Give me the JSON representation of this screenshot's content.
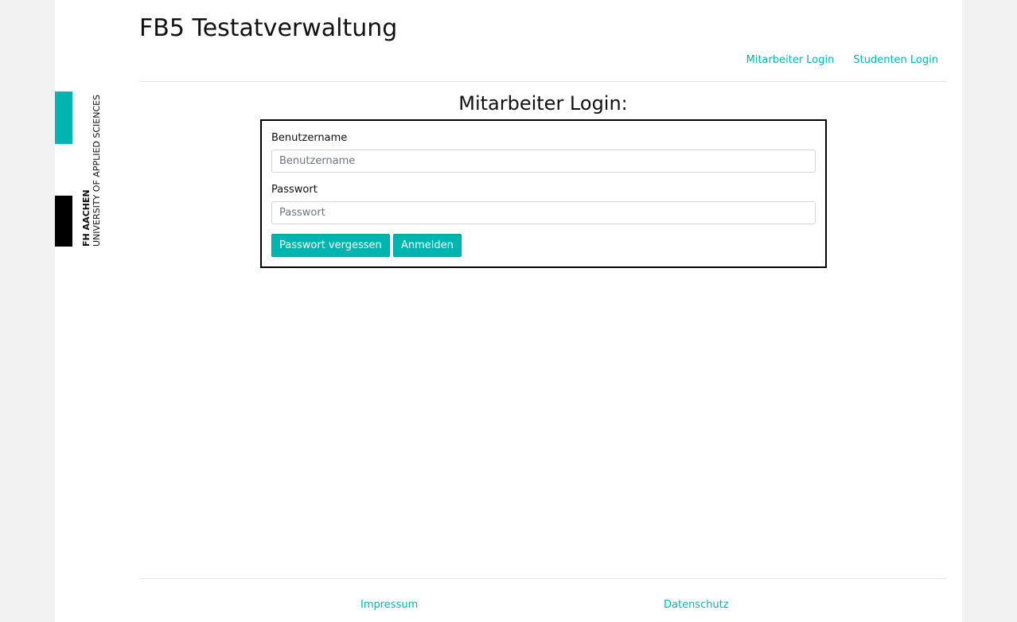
{
  "logo": {
    "name": "FH AACHEN",
    "subtitle": "UNIVERSITY OF APPLIED SCIENCES",
    "accent_color": "#00b4b0"
  },
  "header": {
    "title": "FB5 Testatverwaltung",
    "nav": [
      {
        "label": "Mitarbeiter Login"
      },
      {
        "label": "Studenten Login"
      }
    ]
  },
  "login": {
    "heading": "Mitarbeiter Login:",
    "username_label": "Benutzername",
    "username_placeholder": "Benutzername",
    "password_label": "Passwort",
    "password_placeholder": "Passwort",
    "forgot_button": "Passwort vergessen",
    "submit_button": "Anmelden"
  },
  "footer": {
    "links": [
      {
        "label": "Impressum"
      },
      {
        "label": "Datenschutz"
      }
    ]
  }
}
